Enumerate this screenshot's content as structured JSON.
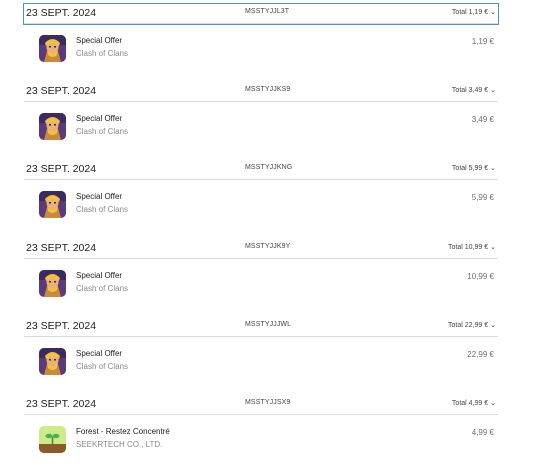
{
  "orders": [
    {
      "date": "23 SEPT. 2024",
      "order_id": "MSSTYJJL3T",
      "total": "Total 1,19 €",
      "selected": true,
      "item": {
        "name": "Special Offer",
        "developer": "Clash of Clans",
        "price": "1,19 €",
        "icon": "clash-of-clans-barbarian-icon"
      }
    },
    {
      "date": "23 SEPT. 2024",
      "order_id": "MSSTYJJKS9",
      "total": "Total 3,49 €",
      "selected": false,
      "item": {
        "name": "Special Offer",
        "developer": "Clash of Clans",
        "price": "3,49 €",
        "icon": "clash-of-clans-barbarian-icon"
      }
    },
    {
      "date": "23 SEPT. 2024",
      "order_id": "MSSTYJJKNG",
      "total": "Total 5,99 €",
      "selected": false,
      "item": {
        "name": "Special Offer",
        "developer": "Clash of Clans",
        "price": "5,99 €",
        "icon": "clash-of-clans-barbarian-icon"
      }
    },
    {
      "date": "23 SEPT. 2024",
      "order_id": "MSSTYJJK9Y",
      "total": "Total 10,99 €",
      "selected": false,
      "item": {
        "name": "Special Offer",
        "developer": "Clash of Clans",
        "price": "10,99 €",
        "icon": "clash-of-clans-barbarian-icon"
      }
    },
    {
      "date": "23 SEPT. 2024",
      "order_id": "MSSTYJJJWL",
      "total": "Total 22,99 €",
      "selected": false,
      "item": {
        "name": "Special Offer",
        "developer": "Clash of Clans",
        "price": "22,99 €",
        "icon": "clash-of-clans-barbarian-icon"
      }
    },
    {
      "date": "23 SEPT. 2024",
      "order_id": "MSSTYJJSX9",
      "total": "Total 4,99 €",
      "selected": false,
      "item": {
        "name": "Forest - Restez Concentré",
        "developer": "SEEKRTECH CO., LTD.",
        "price": "4,99 €",
        "icon": "forest-sprout-icon"
      }
    }
  ],
  "chevron": "⌄",
  "colors": {
    "selection_outline": "#4a90d9",
    "divider": "#d9d9d9",
    "secondary_text": "#8a8a8e"
  }
}
